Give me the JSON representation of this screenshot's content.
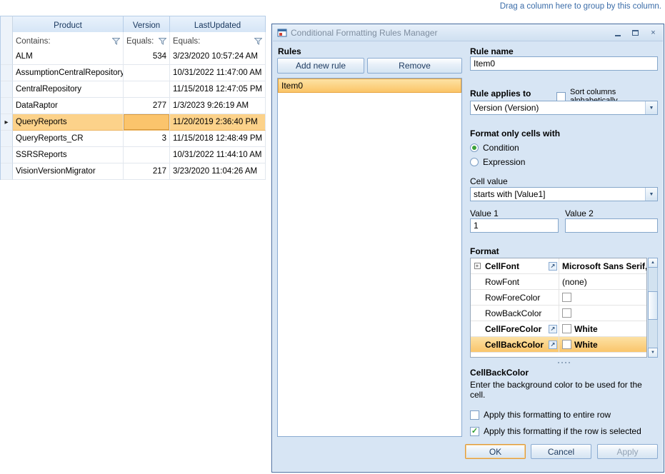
{
  "page": {
    "group_hint": "Drag a column here to group by this column."
  },
  "icons": {
    "close": "×",
    "check": "✓",
    "focused_row": "▸",
    "dropdown_arrow": "▼",
    "scroll_up": "▲",
    "scroll_down": "▼",
    "expander": "+",
    "goto": "↗"
  },
  "grid": {
    "columns": {
      "product": "Product",
      "version": "Version",
      "last_updated": "LastUpdated"
    },
    "filters": {
      "product": "Contains:",
      "version": "Equals:",
      "last_updated": "Equals:"
    },
    "rows": [
      {
        "product": "ALM",
        "version": "534",
        "last_updated": "3/23/2020 10:57:24 AM"
      },
      {
        "product": "AssumptionCentralRepository",
        "version": "",
        "last_updated": "10/31/2022 11:47:00 AM"
      },
      {
        "product": "CentralRepository",
        "version": "",
        "last_updated": "11/15/2018 12:47:05 PM"
      },
      {
        "product": "DataRaptor",
        "version": "277",
        "last_updated": "1/3/2023 9:26:19 AM"
      },
      {
        "product": "QueryReports",
        "version": "",
        "last_updated": "11/20/2019 2:36:40 PM",
        "selected": true
      },
      {
        "product": "QueryReports_CR",
        "version": "3",
        "last_updated": "11/15/2018 12:48:49 PM"
      },
      {
        "product": "SSRSReports",
        "version": "",
        "last_updated": "10/31/2022 11:44:10 AM"
      },
      {
        "product": "VisionVersionMigrator",
        "version": "217",
        "last_updated": "3/23/2020 11:04:26 AM"
      }
    ]
  },
  "dialog": {
    "title": "Conditional Formatting Rules Manager",
    "rules": {
      "label": "Rules",
      "add_button": "Add new rule",
      "remove_button": "Remove",
      "items": [
        {
          "label": "Item0",
          "selected": true
        }
      ]
    },
    "rule_name": {
      "label": "Rule name",
      "value": "Item0"
    },
    "applies_to": {
      "label": "Rule applies to",
      "sort_label": "Sort columns alphabetically",
      "sort_checked": false,
      "value": "Version (Version)"
    },
    "format_cells": {
      "label": "Format only cells with",
      "condition": "Condition",
      "expression": "Expression",
      "selected": "Condition"
    },
    "cell_value": {
      "label": "Cell value",
      "value": "starts with [Value1]"
    },
    "value1": {
      "label": "Value 1",
      "value": "1"
    },
    "value2": {
      "label": "Value 2",
      "value": ""
    },
    "format": {
      "label": "Format",
      "properties": [
        {
          "name": "CellFont",
          "value": "Microsoft Sans Serif,"
        },
        {
          "name": "RowFont",
          "value": "(none)"
        },
        {
          "name": "RowForeColor",
          "value": ""
        },
        {
          "name": "RowBackColor",
          "value": ""
        },
        {
          "name": "CellForeColor",
          "value": "White"
        },
        {
          "name": "CellBackColor",
          "value": "White",
          "selected": true
        }
      ]
    },
    "description": {
      "title": "CellBackColor",
      "text": "Enter the background color to be used for the cell."
    },
    "apply_row": {
      "label": "Apply this formatting to entire row",
      "checked": false
    },
    "apply_selected": {
      "label": "Apply this formatting if the row is selected",
      "checked": true
    },
    "buttons": {
      "ok": "OK",
      "cancel": "Cancel",
      "apply": "Apply"
    }
  },
  "colors": {
    "accent_orange": "#FBC567",
    "selection_border": "#E8A33D",
    "dialog_bg": "#D7E5F4",
    "control_border": "#86A7CB",
    "link_blue": "#3A6CA8",
    "green_check": "#2F9E2F"
  }
}
